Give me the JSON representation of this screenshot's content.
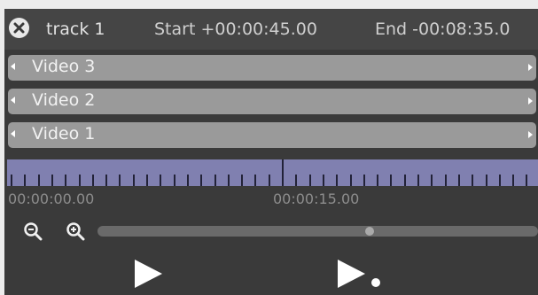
{
  "header": {
    "track_name": "track 1",
    "start_label": "Start +00:00:45.00",
    "end_label": "End -00:08:35.0",
    "close_icon": "close-icon"
  },
  "tracks": [
    {
      "label": "Video 3"
    },
    {
      "label": "Video 2"
    },
    {
      "label": "Video 1"
    }
  ],
  "timeline": {
    "labels": [
      "00:00:00.00",
      "00:00:15.00"
    ]
  },
  "zoom": {
    "zoom_out_icon": "zoom-out-icon",
    "zoom_in_icon": "zoom-in-icon",
    "level": 0.62
  },
  "controls": {
    "play_icon": "play-icon",
    "play_once_icon": "play-once-icon"
  },
  "colors": {
    "panel_bg": "#3a3a3a",
    "row_bg": "#9a9a9a",
    "ruler_bg": "#8080b0"
  }
}
